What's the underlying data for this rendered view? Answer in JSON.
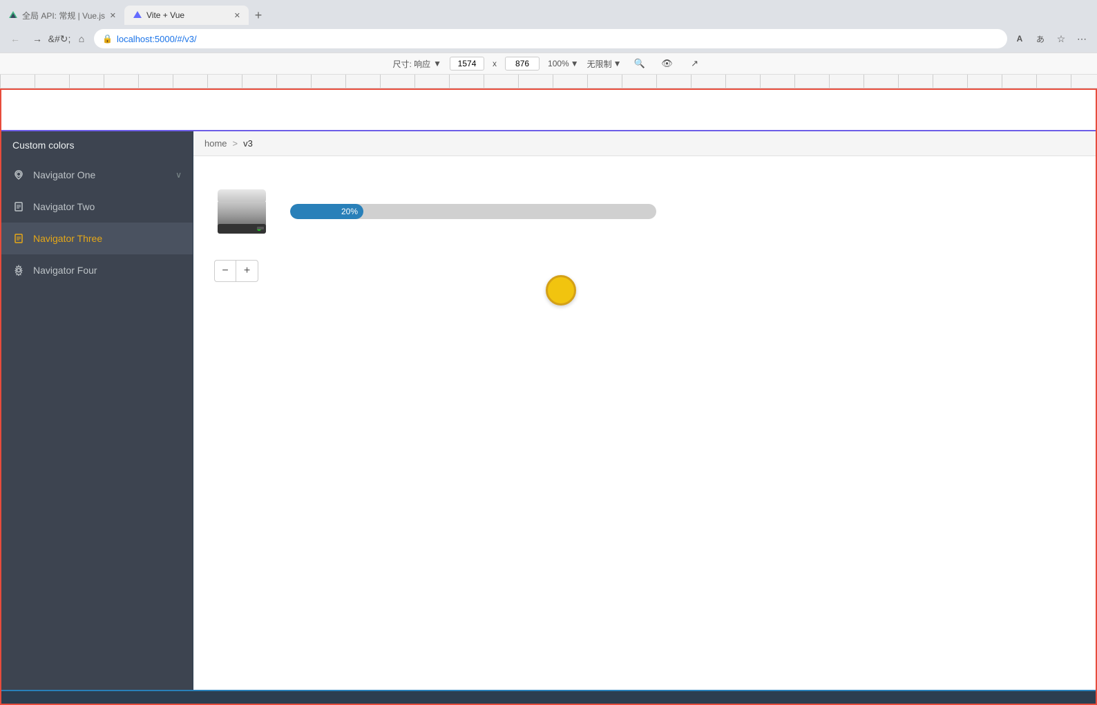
{
  "browser": {
    "tabs": [
      {
        "id": "tab1",
        "title": "全局 API: 常规 | Vue.js",
        "active": false,
        "favicon": "V"
      },
      {
        "id": "tab2",
        "title": "Vite + Vue",
        "active": true,
        "favicon": "V"
      }
    ],
    "address": "localhost:5000/#/v3/",
    "new_tab_label": "+"
  },
  "dev_toolbar": {
    "size_label": "尺寸: 响应",
    "width_value": "1574",
    "x_label": "x",
    "height_value": "876",
    "zoom_label": "100%",
    "limit_label": "无限制"
  },
  "sidebar": {
    "title": "Custom colors",
    "nav_items": [
      {
        "id": "nav1",
        "label": "Navigator One",
        "icon": "location",
        "active": false,
        "has_chevron": true
      },
      {
        "id": "nav2",
        "label": "Navigator Two",
        "icon": "document",
        "active": false,
        "has_chevron": false
      },
      {
        "id": "nav3",
        "label": "Navigator Three",
        "icon": "document",
        "active": true,
        "has_chevron": false
      },
      {
        "id": "nav4",
        "label": "Navigator Four",
        "icon": "gear",
        "active": false,
        "has_chevron": false
      }
    ]
  },
  "breadcrumb": {
    "home": "home",
    "separator": ">",
    "current": "v3"
  },
  "progress": {
    "value": 20,
    "label": "20%",
    "max": 100
  },
  "controls": {
    "decrement_label": "−",
    "increment_label": "+"
  },
  "colors": {
    "sidebar_bg": "#3d4450",
    "active_nav_color": "#e6a817",
    "progress_fill": "#2980b9",
    "progress_bg": "#c8c8c8",
    "yellow_circle": "#f1c40f",
    "header_border": "#e74c3c",
    "footer_border": "#2980b9",
    "divider": "#6c5ce7"
  }
}
